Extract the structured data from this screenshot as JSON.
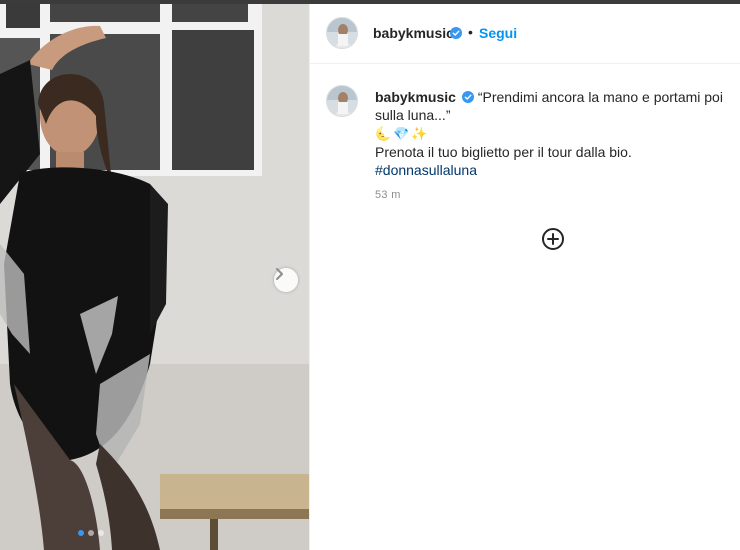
{
  "post": {
    "username": "babykmusic",
    "verified": true,
    "separator": "•",
    "follow_label": "Segui",
    "caption": {
      "quote": "“Prendimi ancora la mano e portami poi sulla luna...”",
      "emojis": "🌜💎✨",
      "line2": "Prenota il tuo biglietto per il tour dalla bio.",
      "hashtag": "#donnasullaluna"
    },
    "timestamp": "53 m",
    "carousel": {
      "current_index": 1,
      "total": 3
    }
  },
  "icons": {
    "avatar": "profile-avatar",
    "verified": "verified-badge-icon",
    "next": "chevron-right-icon",
    "more_comments": "plus-circle-icon"
  },
  "colors": {
    "link_blue": "#0095f6",
    "hashtag_blue": "#00376b",
    "verified_blue": "#3897f0",
    "muted_gray": "#8e8e8e"
  }
}
